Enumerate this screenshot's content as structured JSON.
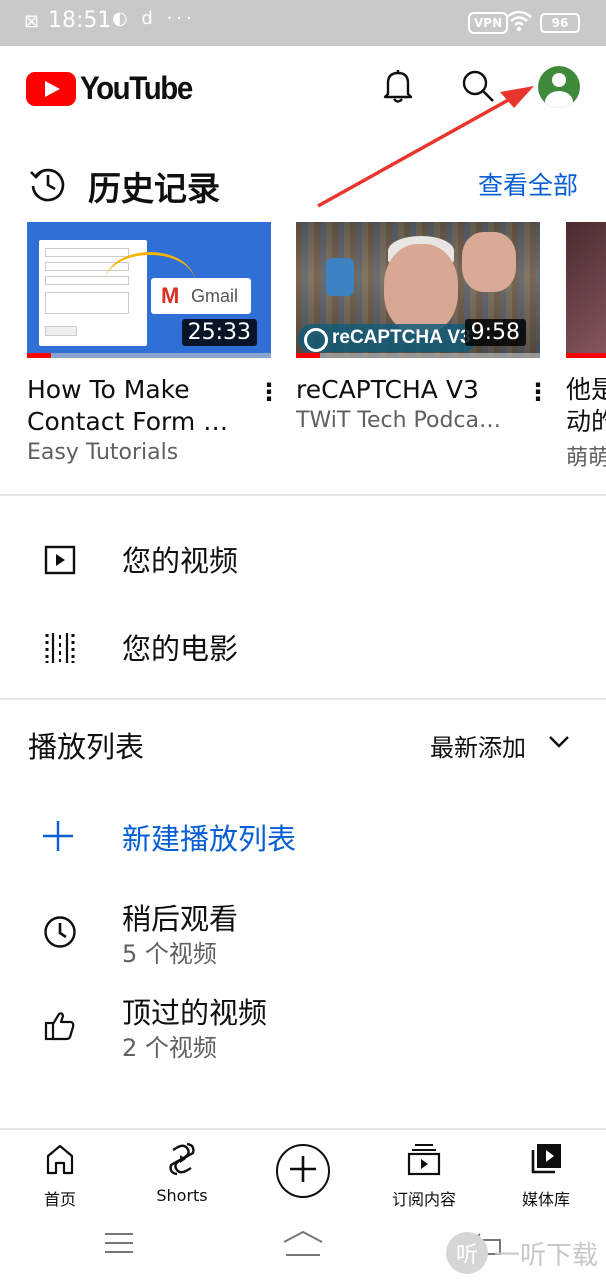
{
  "status_bar": {
    "time": "18:51",
    "app_icons": "◐ d ···",
    "vpn": "VPN",
    "battery": "96"
  },
  "header": {
    "logo_text": "YouTube",
    "icons": [
      "bell-icon",
      "search-icon",
      "account-avatar"
    ]
  },
  "history": {
    "title": "历史记录",
    "view_all": "查看全部",
    "videos": [
      {
        "title": "How To Make\nContact Form …",
        "channel": "Easy Tutorials",
        "duration": "25:33",
        "watched_fraction": 0.1,
        "thumb_text": "Gmail"
      },
      {
        "title": "reCAPTCHA V3",
        "channel": "TWiT Tech Podca…",
        "duration": "9:58",
        "watched_fraction": 0.1,
        "thumb_text": "reCAPTCHA V3"
      },
      {
        "title": "他是\n动的",
        "channel": "萌萌",
        "duration": "",
        "watched_fraction": 0.4,
        "thumb_text": ""
      }
    ]
  },
  "library": {
    "your_videos": "您的视频",
    "your_movies": "您的电影"
  },
  "playlists": {
    "title": "播放列表",
    "sort": "最新添加",
    "new_playlist": "新建播放列表",
    "items": [
      {
        "title": "稍后观看",
        "count": "5 个视频",
        "icon": "clock-icon"
      },
      {
        "title": "顶过的视频",
        "count": "2 个视频",
        "icon": "thumbs-up-icon"
      }
    ]
  },
  "bottom_nav": {
    "home": "首页",
    "shorts": "Shorts",
    "subscriptions": "订阅内容",
    "library": "媒体库"
  },
  "watermark": {
    "text": "一听下载",
    "logo_glyph": "听"
  },
  "colors": {
    "brand_red": "#ff0000",
    "link_blue": "#065fd4",
    "annotation_arrow": "#e8362f"
  }
}
